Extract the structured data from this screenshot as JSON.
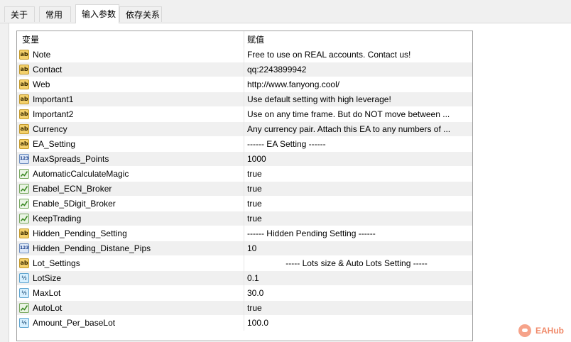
{
  "tabs": [
    {
      "label": "关于",
      "active": false
    },
    {
      "label": "常用",
      "active": false
    },
    {
      "label": "输入参数",
      "active": true
    },
    {
      "label": "依存关系",
      "active": false
    }
  ],
  "table": {
    "headers": {
      "variable": "变量",
      "value": "赋值"
    },
    "rows": [
      {
        "type": "ab",
        "name": "Note",
        "value": "Free to use on REAL accounts. Contact us!"
      },
      {
        "type": "ab",
        "name": "Contact",
        "value": "qq:2243899942"
      },
      {
        "type": "ab",
        "name": "Web",
        "value": "http://www.fanyong.cool/"
      },
      {
        "type": "ab",
        "name": "Important1",
        "value": "Use default setting with high leverage!"
      },
      {
        "type": "ab",
        "name": "Important2",
        "value": "Use on any time frame. But do NOT move between ..."
      },
      {
        "type": "ab",
        "name": "Currency",
        "value": "Any currency pair. Attach this EA to any numbers of ..."
      },
      {
        "type": "ab",
        "name": "EA_Setting",
        "value": "------ EA Setting ------"
      },
      {
        "type": "num",
        "name": "MaxSpreads_Points",
        "value": "1000"
      },
      {
        "type": "bool",
        "name": "AutomaticCalculateMagic",
        "value": "true"
      },
      {
        "type": "bool",
        "name": "Enabel_ECN_Broker",
        "value": "true"
      },
      {
        "type": "bool",
        "name": "Enable_5Digit_Broker",
        "value": "true"
      },
      {
        "type": "bool",
        "name": "KeepTrading",
        "value": "true"
      },
      {
        "type": "ab",
        "name": "Hidden_Pending_Setting",
        "value": "------ Hidden Pending Setting ------"
      },
      {
        "type": "num",
        "name": "Hidden_Pending_Distane_Pips",
        "value": "10"
      },
      {
        "type": "ab",
        "name": "Lot_Settings",
        "value": "----- Lots size & Auto Lots Setting -----",
        "center": true
      },
      {
        "type": "dbl",
        "name": "LotSize",
        "value": "0.1"
      },
      {
        "type": "dbl",
        "name": "MaxLot",
        "value": "30.0"
      },
      {
        "type": "bool",
        "name": "AutoLot",
        "value": "true"
      },
      {
        "type": "dbl",
        "name": "Amount_Per_baseLot",
        "value": "100.0"
      }
    ]
  },
  "icons": {
    "ab": "string-type-icon",
    "num": "integer-type-icon",
    "bool": "boolean-type-icon",
    "dbl": "double-type-icon"
  },
  "watermark": {
    "text": "EAHub"
  }
}
